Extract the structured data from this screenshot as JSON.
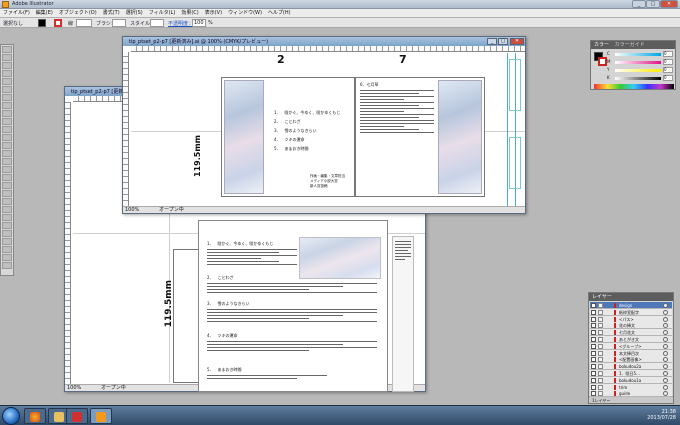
{
  "app": {
    "title": "Adobe Illustrator",
    "menus": [
      "ファイル(F)",
      "編集(E)",
      "オブジェクト(O)",
      "書式(T)",
      "選択(S)",
      "フィルタ(L)",
      "効果(C)",
      "表示(V)",
      "ウィンドウ(W)",
      "ヘルプ(H)"
    ]
  },
  "control_bar": {
    "selection_label": "選択なし",
    "stroke_label": "線",
    "brush_label": "ブラシ：",
    "style_label": "スタイル：",
    "opacity_label": "不透明度：",
    "opacity_value": "100",
    "percent": "%"
  },
  "front_window": {
    "title": "tip_ptset_p2-p7 [更新済み].ai @ 100% (CMYK/プレビュー)",
    "zoom": "100%",
    "status": "オープン中",
    "page_left_number": "2",
    "page_right_number": "7",
    "vertical_size": "119.5mm",
    "toc_items": [
      "1．　咲かぐ、今ゆく、咲かゆくもじ",
      "2．　ことわざ",
      "3．　雪のようなきらい",
      "4．　ツキの運命",
      "5．　あまおき時間"
    ],
    "credit_lines": [
      "作画・編集・文章担当",
      "メディア小説大賞",
      "新人賞投稿"
    ],
    "section_heading_right": "6．七月草"
  },
  "back_window": {
    "title": "tip_ptset_p2-p7 [更新済み].ai",
    "zoom": "100%",
    "status": "オープン中",
    "vertical_size": "119.5mm",
    "sections": [
      "1．　咲かぐ、今ゆく、咲かゆくもじ",
      "2．　ことわざ",
      "3．　雪のようなきらい",
      "4．　ツキの運命",
      "5．　あまおき時間"
    ]
  },
  "color_panel": {
    "title": "カラー",
    "tab2": "カラーガイド",
    "channels": [
      "C",
      "M",
      "Y",
      "K"
    ],
    "values": [
      "0",
      "0",
      "0",
      "0"
    ],
    "percent": "%"
  },
  "layers_panel": {
    "title": "レイヤー",
    "footer": "1レイヤー",
    "rows": [
      {
        "name": "design",
        "selected": true
      },
      {
        "name": "紙枠室配字",
        "selected": false
      },
      {
        "name": "<パス>",
        "selected": false
      },
      {
        "name": "花の挿文",
        "selected": false
      },
      {
        "name": "七月花文",
        "selected": false
      },
      {
        "name": "あとがき文",
        "selected": false
      },
      {
        "name": "<グループ>",
        "selected": false
      },
      {
        "name": "本文挿目次",
        "selected": false
      },
      {
        "name": "<配置画像>",
        "selected": false
      },
      {
        "name": "bokudou2a",
        "selected": false
      },
      {
        "name": "1．咲日5…",
        "selected": false
      },
      {
        "name": "bokudou1a",
        "selected": false
      },
      {
        "name": "trim",
        "selected": false
      },
      {
        "name": "guide",
        "selected": false
      }
    ]
  },
  "taskbar": {
    "time": "21:38",
    "date": "2013/07/28"
  }
}
